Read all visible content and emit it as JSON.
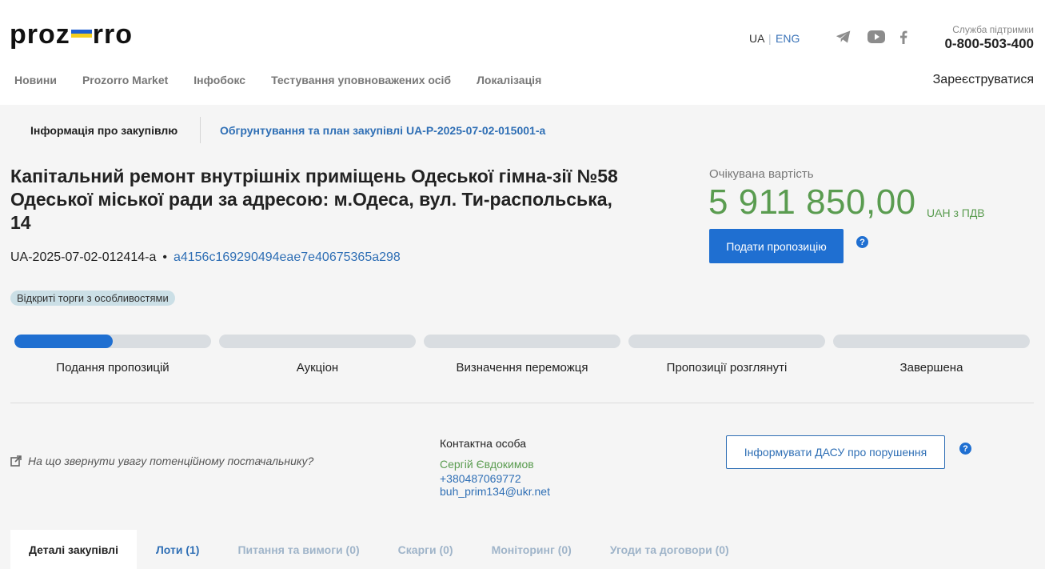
{
  "header": {
    "logo_left": "proz",
    "logo_right": "rro",
    "lang_ua": "UA",
    "lang_sep": "|",
    "lang_eng": "ENG",
    "support_label": "Служба підтримки",
    "support_phone": "0-800-503-400",
    "register": "Зареєструватися",
    "nav": [
      "Новини",
      "Prozorro Market",
      "Інфобокс",
      "Тестування уповноважених осіб",
      "Локалізація"
    ]
  },
  "subnav": {
    "info": "Інформація про закупівлю",
    "plan": "Обгрунтування та план закупівлі UA-P-2025-07-02-015001-a"
  },
  "tender": {
    "title": "Капітальний ремонт внутрішніх приміщень Одеської гімна-зії №58 Одеської міської ради за адресою: м.Одеса, вул. Ти-распольська, 14",
    "id": "UA-2025-07-02-012414-a",
    "bullet": "•",
    "hash": "a4156c169290494eae7e40675365a298",
    "type_badge": "Відкриті торги з особливостями",
    "expected_label": "Очікувана вартість",
    "amount": "5 911 850,00",
    "currency": "UAH з ПДВ",
    "bid_button": "Подати пропозицію"
  },
  "stages": [
    {
      "label": "Подання пропозицій",
      "progress": 0.5
    },
    {
      "label": "Аукціон",
      "progress": 0
    },
    {
      "label": "Визначення переможця",
      "progress": 0
    },
    {
      "label": "Пропозиції розглянуті",
      "progress": 0
    },
    {
      "label": "Завершена",
      "progress": 0
    }
  ],
  "contact": {
    "hint": "На що звернути увагу потенційному постачальнику?",
    "title": "Контактна особа",
    "name": "Сергій Євдокимов",
    "phone": "+380487069772",
    "email": "buh_prim134@ukr.net",
    "dasu_button": "Інформувати ДАСУ про порушення"
  },
  "tabs": [
    {
      "label": "Деталі закупівлі",
      "state": "active"
    },
    {
      "label": "Лоти (1)",
      "state": "link"
    },
    {
      "label": "Питання та вимоги (0)",
      "state": "muted"
    },
    {
      "label": "Скарги (0)",
      "state": "muted"
    },
    {
      "label": "Моніторинг (0)",
      "state": "muted"
    },
    {
      "label": "Угоди та договори (0)",
      "state": "muted"
    }
  ],
  "icons": {
    "telegram": "telegram-icon",
    "youtube": "youtube-icon",
    "facebook": "facebook-icon",
    "help": "?"
  },
  "colors": {
    "accent": "#1f6fd1",
    "link": "#2f6fb5",
    "amount": "#5a9c50"
  }
}
